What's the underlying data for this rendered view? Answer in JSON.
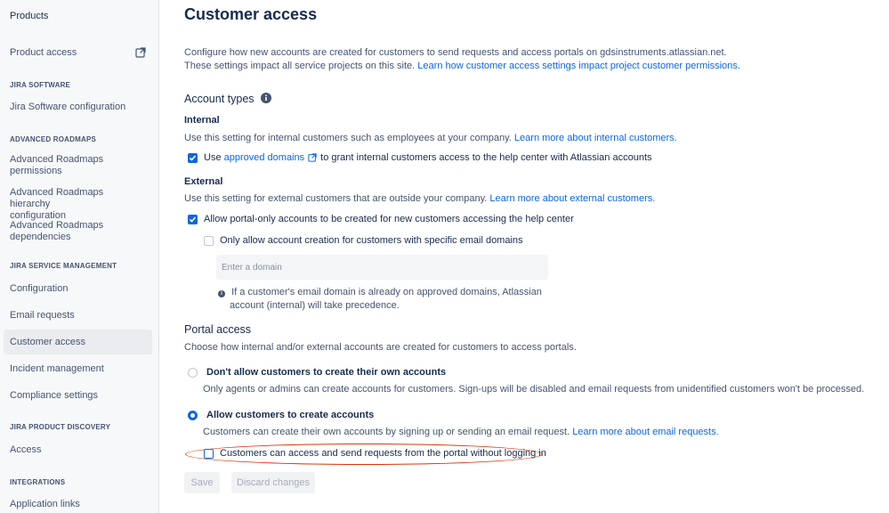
{
  "sidebar": {
    "products_label": "Products",
    "product_access": "Product access",
    "sections": {
      "jira_software": "JIRA SOFTWARE",
      "advanced_roadmaps": "ADVANCED ROADMAPS",
      "jira_service_management": "JIRA SERVICE MANAGEMENT",
      "jira_product_discovery": "JIRA PRODUCT DISCOVERY",
      "integrations": "INTEGRATIONS"
    },
    "items": {
      "jira_software_configuration": "Jira Software configuration",
      "ar_permissions_1": "Advanced Roadmaps",
      "ar_permissions_2": "permissions",
      "ar_hierarchy_1": "Advanced Roadmaps hierarchy",
      "ar_hierarchy_2": "configuration",
      "ar_dependencies_1": "Advanced Roadmaps",
      "ar_dependencies_2": "dependencies",
      "configuration": "Configuration",
      "email_requests": "Email requests",
      "customer_access": "Customer access",
      "incident_management": "Incident management",
      "compliance_settings": "Compliance settings",
      "access": "Access",
      "application_links": "Application links"
    }
  },
  "main": {
    "title": "Customer access",
    "intro_line1": "Configure how new accounts are created for customers to send requests and access portals on gdsinstruments.atlassian.net.",
    "intro_line2": "These settings impact all service projects on this site.",
    "intro_link": "Learn how customer access settings impact project customer permissions.",
    "account_types": {
      "heading": "Account types",
      "internal": {
        "heading": "Internal",
        "desc": "Use this setting for internal customers such as employees at your company.",
        "link": "Learn more about internal customers.",
        "checkbox_pre": "Use",
        "checkbox_link": "approved domains",
        "checkbox_post": "to grant internal customers access to the help center with Atlassian accounts",
        "checked": true
      },
      "external": {
        "heading": "External",
        "desc": "Use this setting for external customers that are outside your company.",
        "link": "Learn more about external customers.",
        "portal_only_label": "Allow portal-only accounts to be created for new customers accessing the help center",
        "portal_only_checked": true,
        "specific_domains_label": "Only allow account creation for customers with specific email domains",
        "specific_domains_checked": false,
        "domain_placeholder": "Enter a domain",
        "info_line1": "If a customer's email domain is already on approved domains, Atlassian",
        "info_line2": "account (internal) will take precedence."
      }
    },
    "portal_access": {
      "heading": "Portal access",
      "desc": "Choose how internal and/or external accounts are created for customers to access portals.",
      "option_disallow": {
        "label": "Don't allow customers to create their own accounts",
        "desc": "Only agents or admins can create accounts for customers. Sign-ups will be disabled and email requests from unidentified customers won't be processed.",
        "selected": false
      },
      "option_allow": {
        "label": "Allow customers to create accounts",
        "desc": "Customers can create their own accounts by signing up or sending an email request.",
        "link": "Learn more about email requests.",
        "selected": true
      },
      "anonymous_label": "Customers can access and send requests from the portal without logging in",
      "anonymous_checked": false
    },
    "buttons": {
      "save": "Save",
      "discard": "Discard changes"
    }
  },
  "colors": {
    "accent": "#0c66e4",
    "highlight": "#de350b",
    "sidebar_bg": "#f7f8f9"
  }
}
